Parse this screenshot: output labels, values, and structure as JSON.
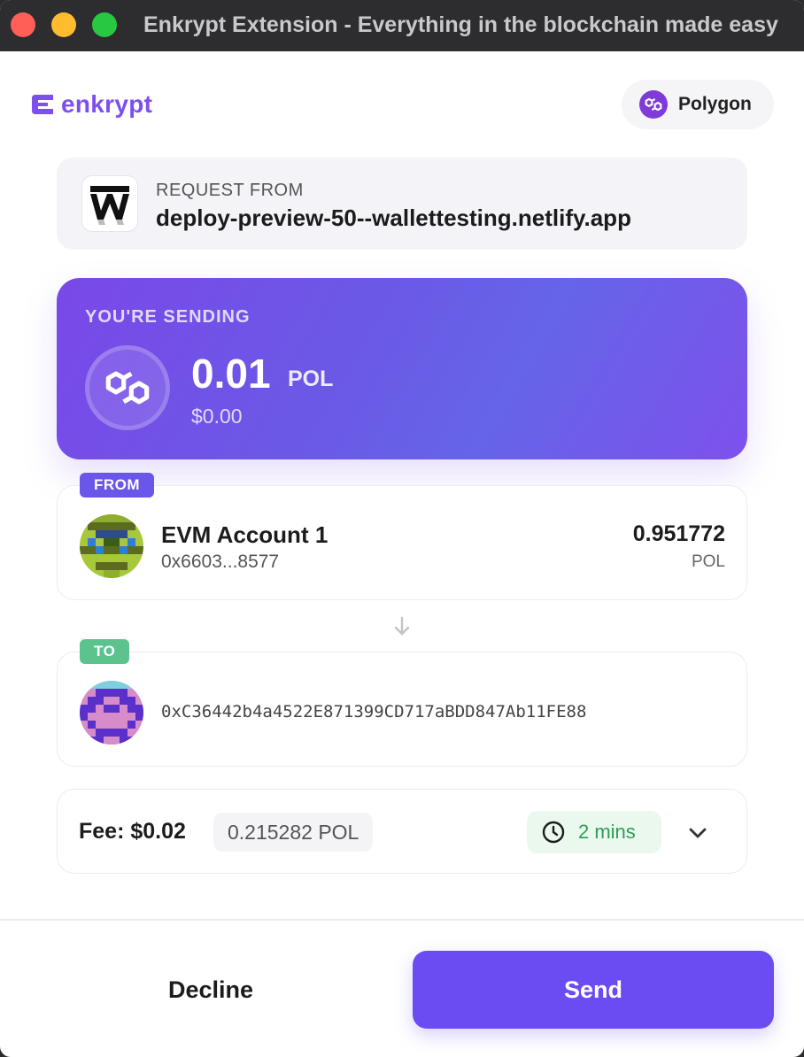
{
  "window": {
    "title": "Enkrypt Extension - Everything in the blockchain made easy"
  },
  "brand": {
    "name": "enkrypt",
    "color": "#7d4ff0"
  },
  "network": {
    "label": "Polygon",
    "icon": "polygon-icon"
  },
  "request": {
    "label": "REQUEST FROM",
    "url": "deploy-preview-50--wallettesting.netlify.app",
    "site_icon": "w-site-logo"
  },
  "sending": {
    "label": "YOU'RE SENDING",
    "amount": "0.01",
    "unit": "POL",
    "fiat": "$0.00",
    "icon": "polygon-icon"
  },
  "from": {
    "tag": "FROM",
    "name": "EVM Account 1",
    "address": "0x6603...8577",
    "balance": "0.951772",
    "balance_unit": "POL"
  },
  "to": {
    "tag": "TO",
    "address": "0xC36442b4a4522E871399CD717aBDD847Ab11FE88"
  },
  "fee": {
    "label": "Fee: $0.02",
    "native": "0.215282 POL",
    "time": "2 mins"
  },
  "actions": {
    "decline_label": "Decline",
    "send_label": "Send"
  },
  "colors": {
    "accent": "#6a4cf2",
    "from_tag": "#6a56e8",
    "to_tag": "#5cc38f",
    "fee_time": "#2f9e55"
  }
}
